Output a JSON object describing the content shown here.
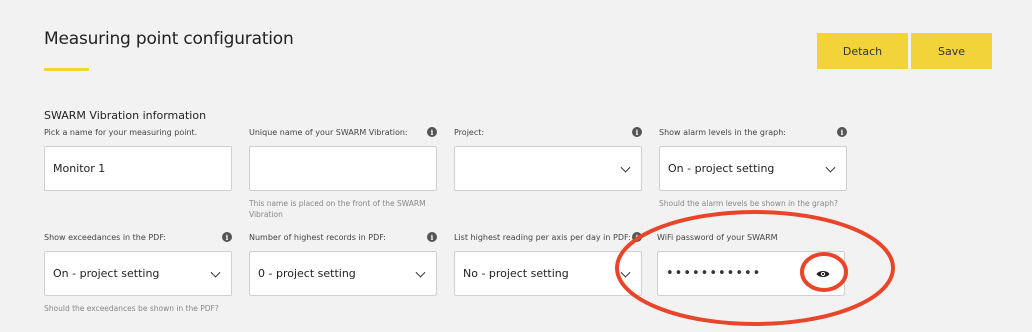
{
  "header": {
    "title": "Measuring point configuration"
  },
  "actions": {
    "detach_label": "Detach",
    "save_label": "Save"
  },
  "section": {
    "title": "SWARM Vibration information"
  },
  "fields": {
    "name": {
      "label": "Pick a name for your measuring point.",
      "value": "Monitor 1"
    },
    "unique_name": {
      "label": "Unique name of your SWARM Vibration:",
      "value": "",
      "help": "This name is placed on the front of the SWARM Vibration"
    },
    "project": {
      "label": "Project:",
      "value": ""
    },
    "alarm_levels": {
      "label": "Show alarm levels in the graph:",
      "value": "On - project setting",
      "help": "Should the alarm levels be shown in the graph?"
    },
    "exceedances": {
      "label": "Show exceedances in the PDF:",
      "value": "On - project setting",
      "help": "Should the exceedances be shown in the PDF?"
    },
    "highest_records": {
      "label": "Number of highest records in PDF:",
      "value": "0 - project setting"
    },
    "highest_reading": {
      "label": "List highest reading per axis per day in PDF:",
      "value": "No - project setting"
    },
    "wifi_password": {
      "label": "WiFi password of your SWARM",
      "value": "•••••••••••"
    }
  },
  "icons": {
    "info": "info-icon",
    "chevron": "chevron-down-icon",
    "eye": "eye-icon"
  },
  "colors": {
    "accent": "#f2d43a",
    "annotation": "#e8462a",
    "background": "#f2f2f2"
  }
}
